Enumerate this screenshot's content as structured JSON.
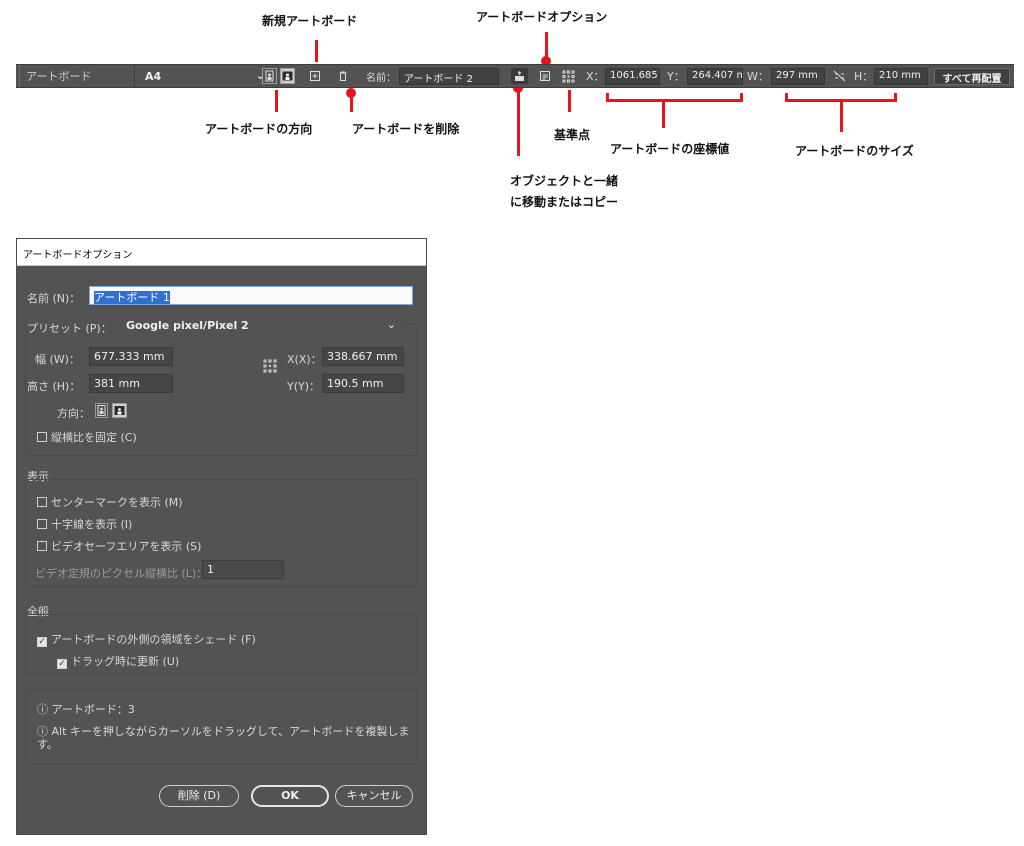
{
  "annotations": {
    "new_artboard": "新規アートボード",
    "artboard_options": "アートボードオプション",
    "orientation": "アートボードの方向",
    "delete_artboard": "アートボードを削除",
    "reference_point": "基準点",
    "coordinates": "アートボードの座標値",
    "size": "アートボードのサイズ",
    "move_copy_line1": "オブジェクトと一緒",
    "move_copy_line2": "に移動またはコピー"
  },
  "toolbar": {
    "label": "アートボード",
    "preset": "A4",
    "name_label": "名前：",
    "name_value": "アートボード 2",
    "x_label": "X：",
    "x_value": "1061.685",
    "y_label": "Y：",
    "y_value": "264.407 m",
    "w_label": "W：",
    "w_value": "297 mm",
    "h_label": "H：",
    "h_value": "210 mm",
    "rearrange_button": "すべて再配置"
  },
  "dialog": {
    "title": "アートボードオプション",
    "name_label": "名前 (N)：",
    "name_value": "アートボード 1",
    "preset_label": "プリセット (P)：",
    "preset_value": "Google pixel/Pixel 2",
    "width_label": "幅 (W)：",
    "width_value": "677.333 mm",
    "height_label": "高さ (H)：",
    "height_value": "381 mm",
    "x_label": "X(X)：",
    "x_value": "338.667 mm",
    "y_label": "Y(Y)：",
    "y_value": "190.5 mm",
    "orientation_label": "方向：",
    "lock_ratio": "縦横比を固定 (C)",
    "display_heading": "表示",
    "center_mark": "センターマークを表示 (M)",
    "cross_hairs": "十字線を表示 (I)",
    "video_safe": "ビデオセーフエリアを表示 (S)",
    "pixel_ratio_label": "ビデオ定規のピクセル縦横比 (L)：",
    "pixel_ratio_value": "1",
    "general_heading": "全般",
    "shade_outside": "アートボードの外側の領域をシェード (F)",
    "update_drag": "ドラッグ時に更新 (U)",
    "info_count": "アートボード：3",
    "info_tip": "Alt キーを押しながらカーソルをドラッグして、アートボードを複製します。",
    "delete_button": "削除 (D)",
    "ok_button": "OK",
    "cancel_button": "キャンセル"
  }
}
